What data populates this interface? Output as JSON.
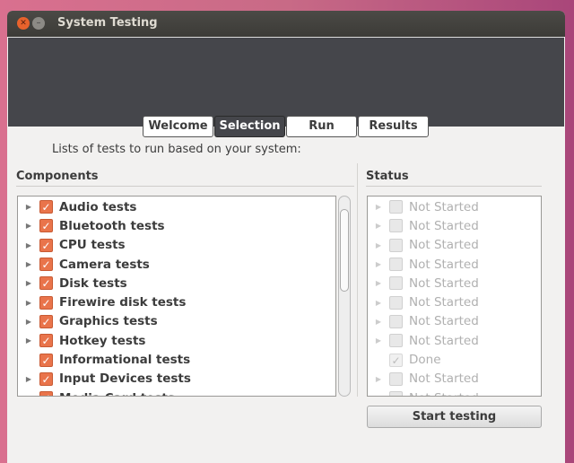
{
  "window": {
    "title": "System Testing"
  },
  "tabs": [
    {
      "label": "Welcome"
    },
    {
      "label": "Selection"
    },
    {
      "label": "Run"
    },
    {
      "label": "Results"
    }
  ],
  "active_tab": "Selection",
  "subtitle": "Lists of tests to run based on your system:",
  "components": {
    "header": "Components",
    "items": [
      {
        "label": "Audio tests",
        "checked": true,
        "expandable": true
      },
      {
        "label": "Bluetooth tests",
        "checked": true,
        "expandable": true
      },
      {
        "label": "CPU tests",
        "checked": true,
        "expandable": true
      },
      {
        "label": "Camera tests",
        "checked": true,
        "expandable": true
      },
      {
        "label": "Disk tests",
        "checked": true,
        "expandable": true
      },
      {
        "label": "Firewire disk tests",
        "checked": true,
        "expandable": true
      },
      {
        "label": "Graphics tests",
        "checked": true,
        "expandable": true
      },
      {
        "label": "Hotkey tests",
        "checked": true,
        "expandable": true
      },
      {
        "label": "Informational tests",
        "checked": true,
        "expandable": false
      },
      {
        "label": "Input Devices tests",
        "checked": true,
        "expandable": true
      },
      {
        "label": "Media Card tests",
        "checked": true,
        "expandable": true
      }
    ]
  },
  "status": {
    "header": "Status",
    "items": [
      {
        "label": "Not Started",
        "state": "off"
      },
      {
        "label": "Not Started",
        "state": "off"
      },
      {
        "label": "Not Started",
        "state": "off"
      },
      {
        "label": "Not Started",
        "state": "off"
      },
      {
        "label": "Not Started",
        "state": "off"
      },
      {
        "label": "Not Started",
        "state": "off"
      },
      {
        "label": "Not Started",
        "state": "off"
      },
      {
        "label": "Not Started",
        "state": "off"
      },
      {
        "label": "Done",
        "state": "done"
      },
      {
        "label": "Not Started",
        "state": "off"
      },
      {
        "label": "Not Started",
        "state": "off"
      }
    ]
  },
  "start_button": "Start testing",
  "colors": {
    "accent": "#e9744b",
    "header_bg": "#45464b",
    "close": "#e8622c"
  }
}
